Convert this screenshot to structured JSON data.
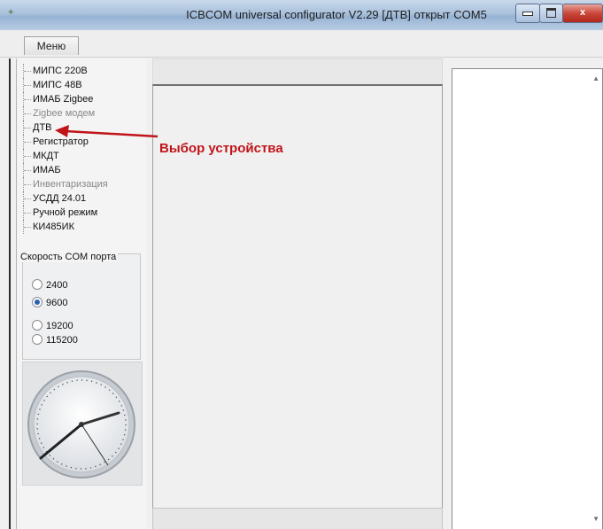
{
  "window": {
    "title": "ICBCOM universal configurator V2.29 [ДТВ] открыт COM5",
    "controls": {
      "close": "x"
    }
  },
  "menu": {
    "label": "Меню"
  },
  "devices": [
    {
      "label": "МИПС 220В",
      "dim": false
    },
    {
      "label": "МИПС 48В",
      "dim": false
    },
    {
      "label": "ИМАБ Zigbee",
      "dim": false
    },
    {
      "label": "Zigbee модем",
      "dim": true
    },
    {
      "label": "ДТВ",
      "dim": false
    },
    {
      "label": "Регистратор",
      "dim": false
    },
    {
      "label": "МКДТ",
      "dim": false
    },
    {
      "label": "ИМАБ",
      "dim": false
    },
    {
      "label": "Инвентаризация",
      "dim": true
    },
    {
      "label": "УСДД 24.01",
      "dim": false
    },
    {
      "label": "Ручной режим",
      "dim": false
    },
    {
      "label": "КИ485ИК",
      "dim": false
    }
  ],
  "com_speed": {
    "title": "Скорость COM порта",
    "options": [
      {
        "label": "2400",
        "checked": false
      },
      {
        "label": "9600",
        "checked": true
      },
      {
        "label": "19200",
        "checked": false
      },
      {
        "label": "115200",
        "checked": false
      }
    ]
  },
  "annotation": {
    "text": "Выбор устройства",
    "color": "#c0141a"
  },
  "colors": {
    "titlebar": "#a9c1dc",
    "close_button": "#c9473a",
    "radio_selected": "#2a5fb4"
  }
}
